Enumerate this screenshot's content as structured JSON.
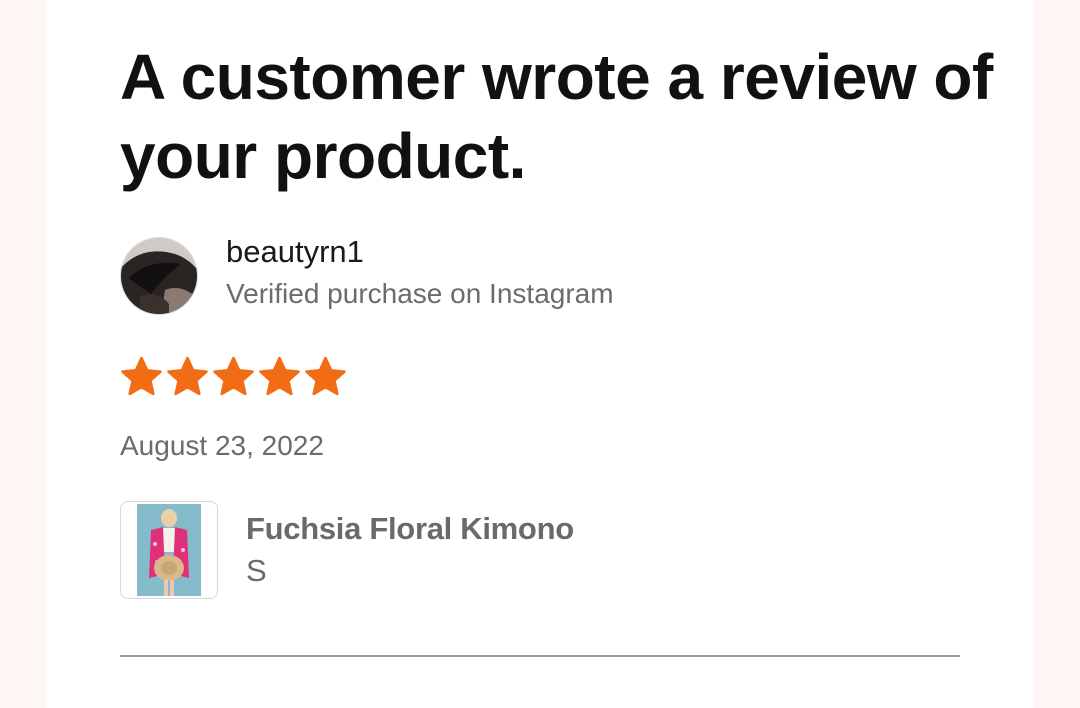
{
  "headline": "A customer wrote a review of your product.",
  "reviewer": {
    "username": "beautyrn1",
    "verification": "Verified purchase on Instagram",
    "avatar_icon": "user-avatar-photo"
  },
  "rating": {
    "stars": 5,
    "max": 5,
    "color": "#f26c15",
    "icon": "star-icon"
  },
  "review_date": "August 23, 2022",
  "product": {
    "name": "Fuchsia Floral Kimono",
    "variant": "S",
    "thumbnail_icon": "product-photo"
  }
}
